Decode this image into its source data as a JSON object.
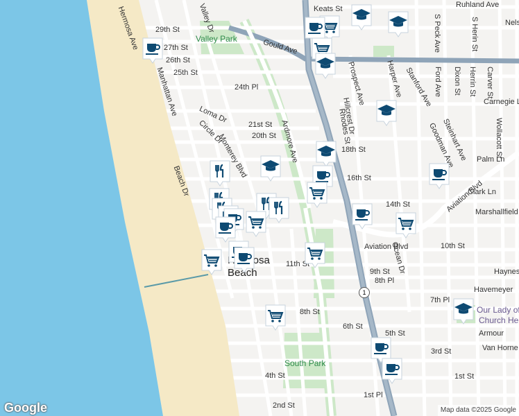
{
  "map": {
    "colors": {
      "water": "#7cc6e7",
      "beach": "#f5e9c6",
      "land": "#f4f3f1",
      "park": "#cde8c8",
      "highway": "#8fa4b8",
      "road": "#ffffff",
      "pin": "#0e4a72"
    },
    "streets": [
      "Keats St",
      "Ruhland Ave",
      "Nelson",
      "29th St",
      "27th St",
      "26th St",
      "25th St",
      "24th Pl",
      "Gould Ave",
      "Valley Dr",
      "Hermosa Ave",
      "Manhattan Ave",
      "Loma Dr",
      "Circle Dr",
      "Monterey Blvd",
      "21st St",
      "20th St",
      "Ardmore Ave",
      "18th St",
      "16th St",
      "14th St",
      "Beach Dr",
      "11th St",
      "10th St",
      "9th St",
      "8th St",
      "8th Pl",
      "7th Pl",
      "6th St",
      "5th St",
      "4th St",
      "3rd St",
      "2nd St",
      "1st St",
      "1st Pl",
      "Prospect Ave",
      "Hillcrest Dr",
      "Rhodes St",
      "Harper Ave",
      "Stanford Ave",
      "S Peck Ave",
      "S Herin St",
      "Ford Ave",
      "Dixon St",
      "Carver St",
      "Herrin St",
      "Carnegie Ln",
      "Steinhart Ave",
      "Goodman Ave",
      "Palm Ln",
      "Wollacott St",
      "Clark Ln",
      "Aviation Blvd",
      "Marshallfield Ln",
      "Ocean Dr",
      "Haynes",
      "Havemeyer",
      "Armour",
      "Van Horne",
      "Aviation Blvd"
    ],
    "parks": [
      "Valley Park",
      "South Park"
    ],
    "city": [
      "Hermosa",
      "Beach"
    ],
    "poi": [
      "Our Lady of",
      "Church He"
    ],
    "route_shield": "1",
    "pins": [
      {
        "type": "cafe-icon"
      },
      {
        "type": "school-icon"
      },
      {
        "type": "school-icon"
      },
      {
        "type": "grocery-icon"
      },
      {
        "type": "cafe-icon"
      },
      {
        "type": "grocery-icon"
      },
      {
        "type": "school-icon"
      },
      {
        "type": "school-icon"
      },
      {
        "type": "school-icon"
      },
      {
        "type": "school-icon"
      },
      {
        "type": "restaurant-icon"
      },
      {
        "type": "cafe-icon"
      },
      {
        "type": "grocery-icon"
      },
      {
        "type": "cafe-icon"
      },
      {
        "type": "restaurant-icon"
      },
      {
        "type": "restaurant-icon"
      },
      {
        "type": "restaurant-icon"
      },
      {
        "type": "cafe-icon"
      },
      {
        "type": "cafe-icon"
      },
      {
        "type": "restaurant-icon"
      },
      {
        "type": "grocery-icon"
      },
      {
        "type": "cafe-icon"
      },
      {
        "type": "cafe-icon"
      },
      {
        "type": "grocery-icon"
      },
      {
        "type": "cafe-icon"
      },
      {
        "type": "grocery-icon"
      },
      {
        "type": "grocery-icon"
      },
      {
        "type": "grocery-icon"
      },
      {
        "type": "school-icon"
      },
      {
        "type": "cafe-icon"
      },
      {
        "type": "cafe-icon"
      },
      {
        "type": "cafe-icon"
      }
    ]
  },
  "footer": {
    "logo": "Google",
    "attribution": "Map data ©2025 Google"
  }
}
